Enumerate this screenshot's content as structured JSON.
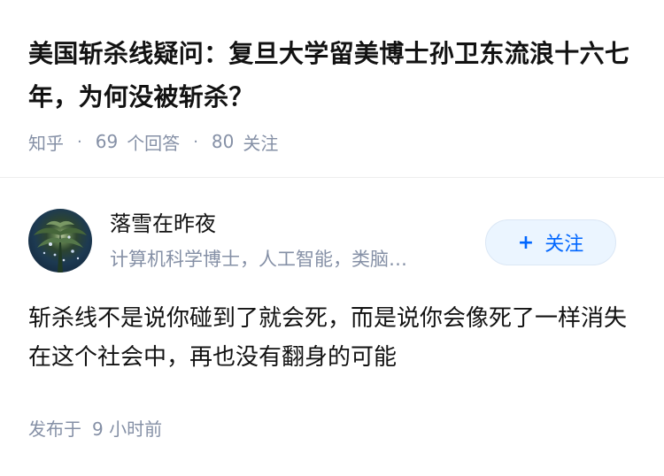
{
  "question": {
    "title": "美国斩杀线疑问：复旦大学留美博士孙卫东流浪十六七年，为何没被斩杀？",
    "source": "知乎",
    "answer_count": "69",
    "answer_count_unit": "个回答",
    "follower_count": "80",
    "follower_label": "关注"
  },
  "answer": {
    "author": {
      "name": "落雪在昨夜",
      "bio": "计算机科学博士，人工智能，类脑…",
      "follow_label": "关注",
      "follow_prefix": "+"
    },
    "content": "斩杀线不是说你碰到了就会死，而是说你会像死了一样消失在这个社会中，再也没有翻身的可能",
    "published_prefix": "发布于",
    "published_time": "9 小时前"
  },
  "colors": {
    "text_primary": "#121212",
    "text_secondary": "#8590a6",
    "accent": "#0066ff",
    "follow_bg": "#ebf5ff"
  },
  "icons": {
    "follow_icon": "plus-icon",
    "avatar": "avatar-image"
  }
}
